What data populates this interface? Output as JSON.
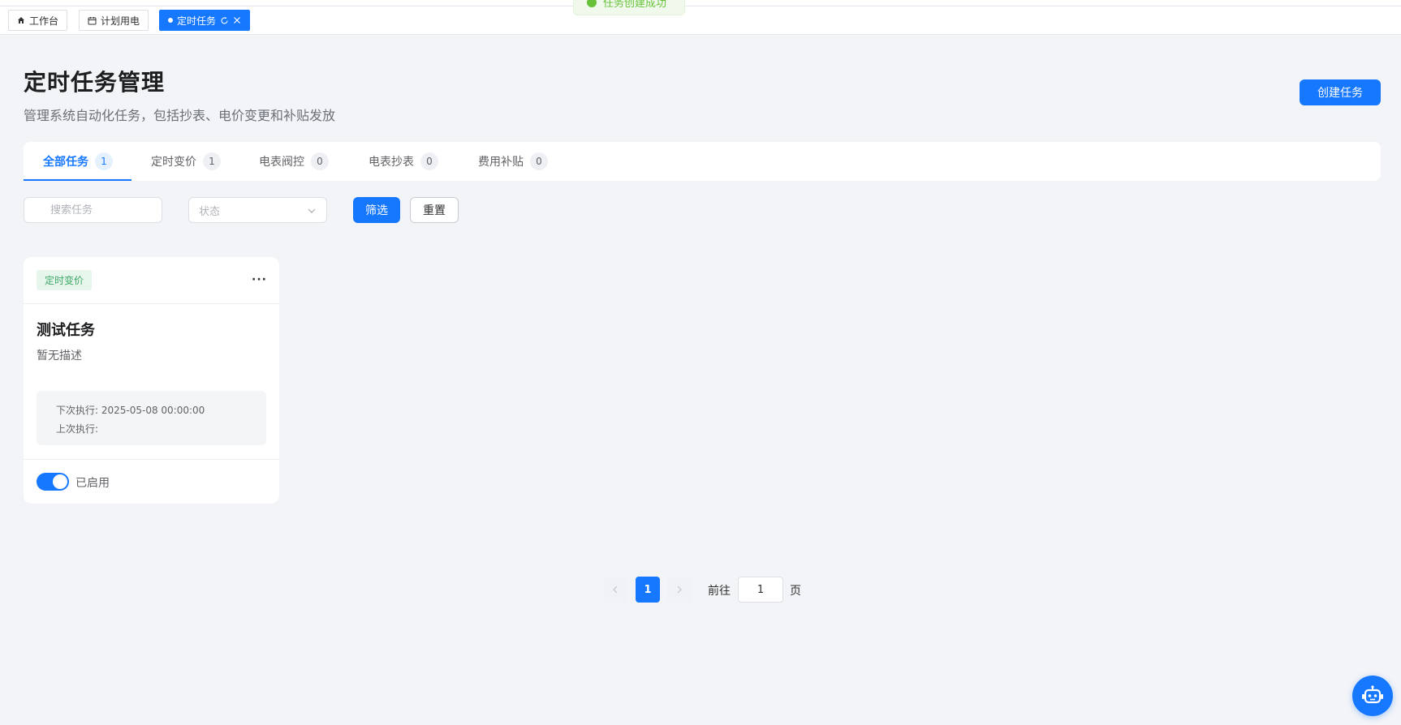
{
  "toast": {
    "text": "任务创建成功"
  },
  "tabs": [
    {
      "label": "工作台",
      "icon": "home-icon"
    },
    {
      "label": "计划用电",
      "icon": "calendar-icon"
    },
    {
      "label": "定时任务",
      "icon": "dot-icon",
      "active": true
    }
  ],
  "header": {
    "title": "定时任务管理",
    "subtitle": "管理系统自动化任务，包括抄表、电价变更和补贴发放",
    "create_label": "创建任务"
  },
  "task_tabs": [
    {
      "label": "全部任务",
      "count": "1",
      "active": true
    },
    {
      "label": "定时变价",
      "count": "1"
    },
    {
      "label": "电表阀控",
      "count": "0"
    },
    {
      "label": "电表抄表",
      "count": "0"
    },
    {
      "label": "费用补贴",
      "count": "0"
    }
  ],
  "filters": {
    "search_placeholder": "搜索任务",
    "status_placeholder": "状态",
    "filter_label": "筛选",
    "reset_label": "重置"
  },
  "card": {
    "tag": "定时变价",
    "more": "···",
    "title": "测试任务",
    "description": "暂无描述",
    "next_run": "下次执行: 2025-05-08 00:00:00",
    "last_run": "上次执行:",
    "enabled": true,
    "status_label": "已启用"
  },
  "pagination": {
    "current": "1",
    "goto_label": "前往",
    "goto_value": "1",
    "page_label": "页"
  },
  "colors": {
    "primary": "#1677ff",
    "tag_green": "#3ea866",
    "success": "#67c23a"
  }
}
